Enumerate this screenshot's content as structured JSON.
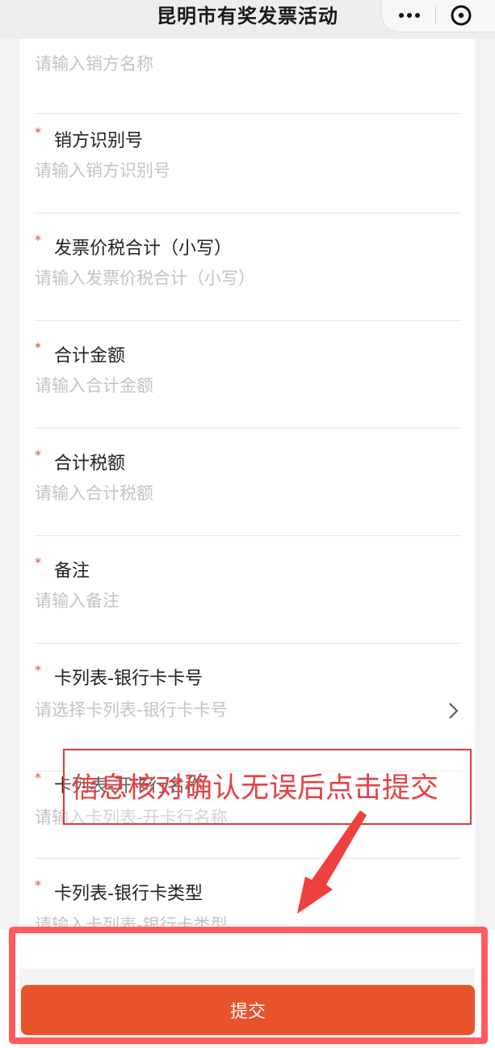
{
  "navbar": {
    "title": "昆明市有奖发票活动"
  },
  "form": {
    "fields": [
      {
        "label": "",
        "placeholder": "请输入销方名称"
      },
      {
        "label": "销方识别号",
        "placeholder": "请输入销方识别号"
      },
      {
        "label": "发票价税合计（小写）",
        "placeholder": "请输入发票价税合计（小写）"
      },
      {
        "label": "合计金额",
        "placeholder": "请输入合计金额"
      },
      {
        "label": "合计税额",
        "placeholder": "请输入合计税额"
      },
      {
        "label": "备注",
        "placeholder": "请输入备注"
      },
      {
        "label": "卡列表-银行卡卡号",
        "placeholder": "请选择卡列表-银行卡卡号"
      },
      {
        "label": "卡列表-开卡行名称",
        "placeholder": "请输入卡列表-开卡行名称"
      },
      {
        "label": "卡列表-银行卡类型",
        "placeholder": "请输入卡列表-银行卡类型"
      }
    ],
    "required_mark": "*"
  },
  "annotation": {
    "text": "信息核对确认无误后点击提交"
  },
  "actions": {
    "submit_label": "提交"
  },
  "colors": {
    "accent": "#e8532b",
    "required": "#e64a27",
    "annotation": "#e03a3a"
  },
  "icons": {
    "more": "more-dots-icon",
    "close": "close-circle-icon",
    "chevron": "chevron-right-icon",
    "arrow": "annotation-arrow-icon"
  }
}
